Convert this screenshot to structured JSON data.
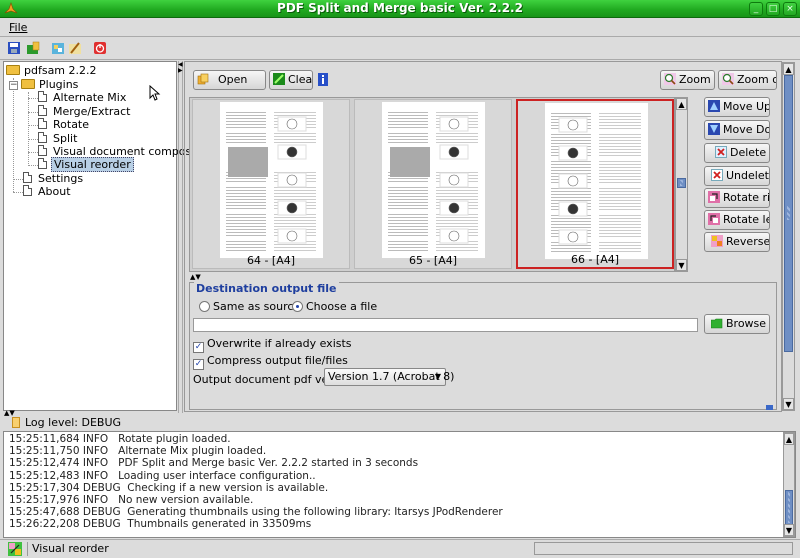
{
  "window": {
    "title": "PDF Split and Merge basic Ver. 2.2.2",
    "controls": [
      "minimize",
      "maximize",
      "close"
    ]
  },
  "menu": {
    "items": [
      {
        "label": "File"
      }
    ]
  },
  "toolbar": {
    "icons": [
      "save-icon",
      "load-icon",
      "settings-icon",
      "clear-icon",
      "exit-icon"
    ]
  },
  "tree": {
    "root": "pdfsam 2.2.2",
    "plugins_label": "Plugins",
    "plugins": [
      "Alternate Mix",
      "Merge/Extract",
      "Rotate",
      "Split",
      "Visual document composer",
      "Visual reorder"
    ],
    "selected": "Visual reorder",
    "others": [
      "Settings",
      "About"
    ]
  },
  "reorder": {
    "open_label": "Open",
    "clear_label": "Clear",
    "zoom_in_label": "Zoom in",
    "zoom_out_label": "Zoom out",
    "actions": [
      "Move Up",
      "Move Do...",
      "Delete",
      "Undelete",
      "Rotate ri...",
      "Rotate left",
      "Reverse"
    ],
    "thumbnails": [
      {
        "caption": "64 - [A4]",
        "selected": false
      },
      {
        "caption": "65 - [A4]",
        "selected": false
      },
      {
        "caption": "66 - [A4]",
        "selected": true
      }
    ],
    "selected_color": "#cc2222"
  },
  "destination": {
    "legend": "Destination output file",
    "radio_same": "Same as source",
    "radio_choose": "Choose a file",
    "selected_radio": "Choose a file",
    "file_value": "",
    "browse_label": "Browse",
    "overwrite_label": "Overwrite if already exists",
    "overwrite_checked": true,
    "compress_label": "Compress output file/files",
    "compress_checked": true,
    "version_label": "Output document pdf version:",
    "version_value": "Version 1.7 (Acrobat 8)"
  },
  "log": {
    "level_label": "Log level: DEBUG",
    "lines": [
      "15:25:11,684 INFO   Rotate plugin loaded.",
      "15:25:11,750 INFO   Alternate Mix plugin loaded.",
      "15:25:12,474 INFO   PDF Split and Merge basic Ver. 2.2.2 started in 3 seconds",
      "15:25:12,483 INFO   Loading user interface configuration..",
      "15:25:17,304 DEBUG  Checking if a new version is available.",
      "15:25:17,976 INFO   No new version available.",
      "15:25:47,688 DEBUG  Generating thumbnails using the following library: Itarsys JPodRenderer",
      "15:26:22,208 DEBUG  Thumbnails generated in 33509ms"
    ]
  },
  "status": {
    "text": "Visual reorder"
  },
  "colors": {
    "titlebar": "#22aa22",
    "accent": "#6f8fc4",
    "legend": "#1f3f9f"
  }
}
